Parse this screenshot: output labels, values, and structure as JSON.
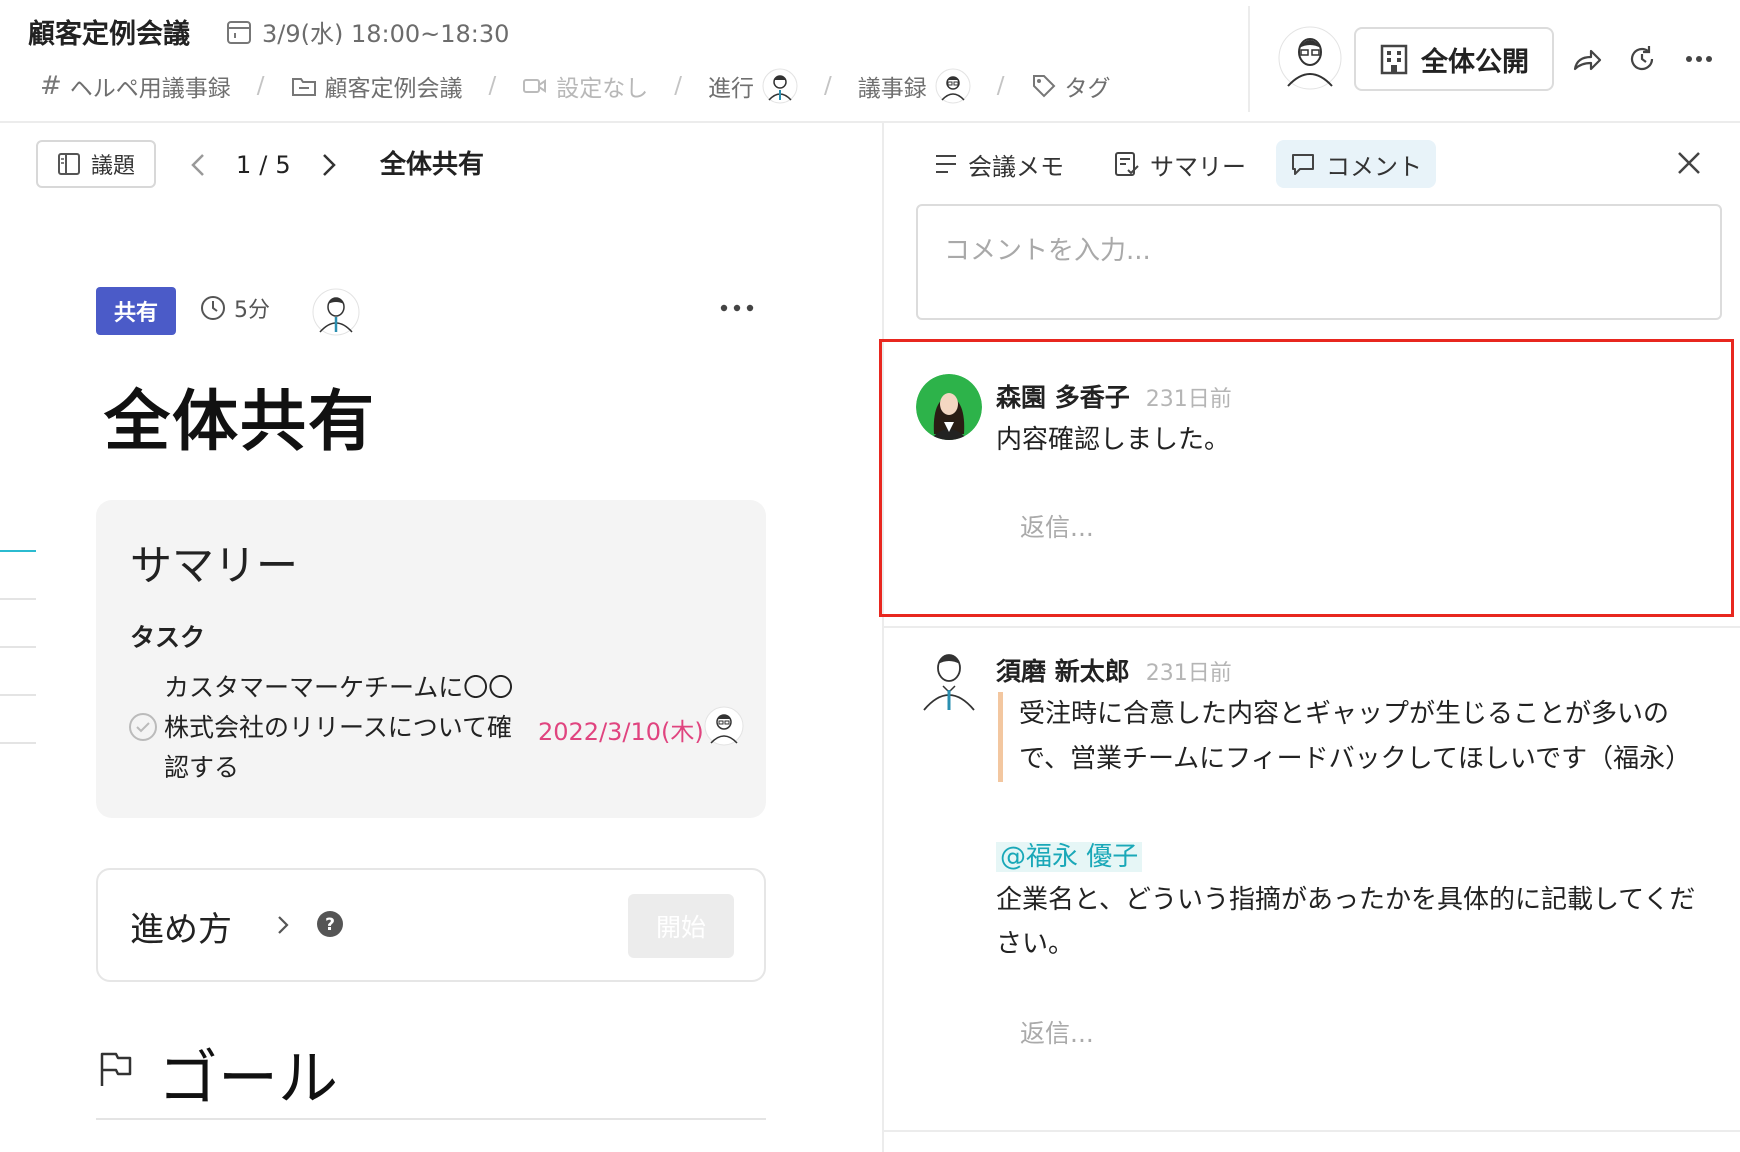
{
  "header": {
    "meeting_title": "顧客定例会議",
    "datetime": "3/9(水) 18:00~18:30",
    "meta_items": [
      {
        "icon": "hash-icon",
        "label": "ヘルペ用議事録"
      },
      {
        "icon": "folder-icon",
        "label": "顧客定例会議"
      },
      {
        "icon": "video-icon",
        "label": "設定なし"
      },
      {
        "label": "進行"
      },
      {
        "label": "議事録"
      },
      {
        "icon": "tag-icon",
        "label": "タグ"
      }
    ],
    "publish_label": "全体公開"
  },
  "left": {
    "topic_button": "議題",
    "page_current": "1",
    "page_sep": "/",
    "page_total": "5",
    "agenda_title": "全体共有",
    "badge": "共有",
    "duration": "5分",
    "big_title": "全体共有",
    "summary": {
      "heading": "サマリー",
      "task_heading": "タスク",
      "task_text": "カスタマーマーケチームに〇〇株式会社のリリースについて確認する",
      "task_date": "2022/3/10(木)"
    },
    "process": {
      "title": "進め方",
      "start_button": "開始"
    },
    "goal_title": "ゴール"
  },
  "right": {
    "tabs": [
      {
        "label": "会議メモ",
        "icon": "list-icon"
      },
      {
        "label": "サマリー",
        "icon": "summary-icon"
      },
      {
        "label": "コメント",
        "icon": "comment-icon",
        "active": true
      }
    ],
    "comment_placeholder": "コメントを入力...",
    "comments": [
      {
        "author": "森園 多香子",
        "time": "231日前",
        "text": "内容確認しました。",
        "reply_placeholder": "返信..."
      },
      {
        "author": "須磨 新太郎",
        "time": "231日前",
        "quote": "受注時に合意した内容とギャップが生じることが多いので、営業チームにフィードバックしてほしいです（福永）",
        "mention": "@福永 優子",
        "text": "企業名と、どういう指摘があったかを具体的に記載してください。",
        "reply_placeholder": "返信..."
      }
    ]
  },
  "colors": {
    "badge": "#4b5bc8",
    "task_date": "#e0447f",
    "highlight": "#e8271f",
    "mention": "#1aa8b8",
    "active_tab": "#e8f3f9"
  }
}
